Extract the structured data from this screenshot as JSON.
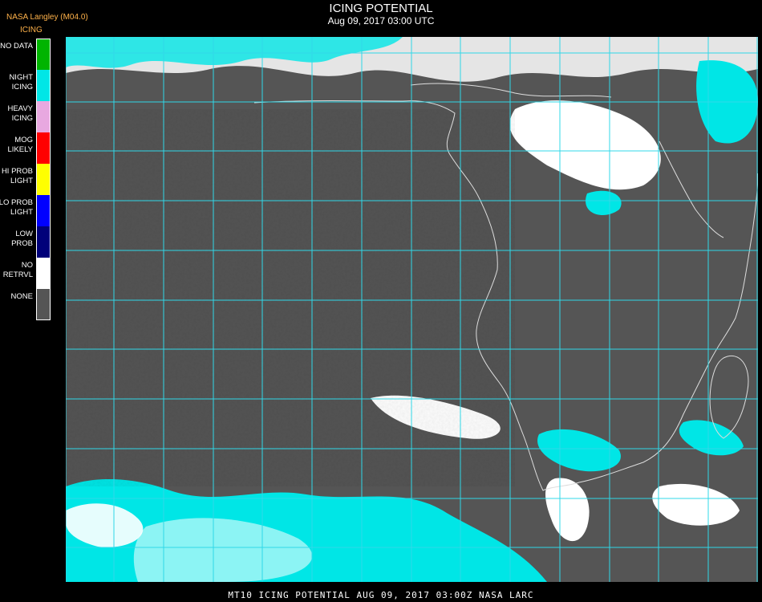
{
  "header": {
    "org_label": "NASA Langley (M04.0)",
    "product_label": "ICING",
    "title": "ICING POTENTIAL",
    "datetime": "Aug 09, 2017 03:00 UTC"
  },
  "legend": [
    {
      "label": "NO DATA",
      "color": "#00b400"
    },
    {
      "label": "NIGHT ICING",
      "color": "#00e6e6"
    },
    {
      "label": "HEAVY ICING",
      "color": "#e8a8e0"
    },
    {
      "label": "MOG LIKELY",
      "color": "#ff0000"
    },
    {
      "label": "HI PROB LIGHT",
      "color": "#ffff00"
    },
    {
      "label": "LO PROB LIGHT",
      "color": "#0000ff"
    },
    {
      "label": "LOW PROB",
      "color": "#00007a"
    },
    {
      "label": "NO RETRVL",
      "color": "#ffffff"
    },
    {
      "label": "NONE",
      "color": "#555555"
    }
  ],
  "footer": "MT10  ICING POTENTIAL   AUG 09, 2017 03:00Z   NASA LARC",
  "map": {
    "background_color": "#555555",
    "grid_color": "#30d8e8",
    "coast_color": "#dddddd",
    "grid_label_color": "#e05050"
  }
}
